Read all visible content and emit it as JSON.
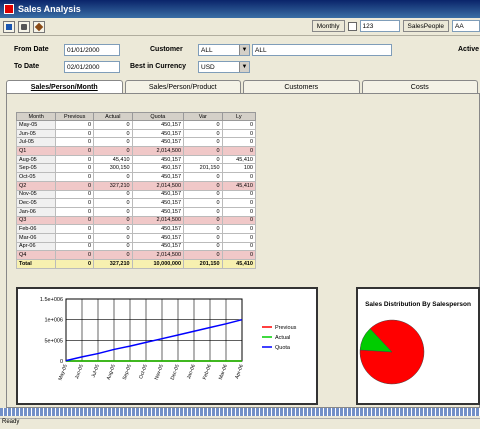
{
  "window": {
    "title": "Sales Analysis"
  },
  "toolbar": {
    "icons": [
      "new-icon",
      "print-icon",
      "tools-icon"
    ]
  },
  "top_right": {
    "monthly_label": "Monthly",
    "value_field": "123",
    "sales_people_label": "SalesPeople",
    "sales_people_value": "AA"
  },
  "filters": {
    "from_date_label": "From Date",
    "from_date_value": "01/01/2000",
    "to_date_label": "To Date",
    "to_date_value": "02/01/2000",
    "customer_label": "Customer",
    "customer_value": "ALL",
    "customer_desc": "ALL",
    "best_currency_label": "Best in Currency",
    "best_currency_value": "USD",
    "active_label": "Active"
  },
  "tabs": [
    {
      "label": "Sales/Person/Month"
    },
    {
      "label": "Sales/Person/Product"
    },
    {
      "label": "Customers"
    },
    {
      "label": "Costs"
    }
  ],
  "table": {
    "headers": [
      "Month",
      "Previous",
      "Actual",
      "Quota",
      "Var",
      "Ly"
    ],
    "rows": [
      {
        "month": "May-05",
        "previous": "0",
        "actual": "0",
        "quota": "450,157",
        "var": "0",
        "ly": "0",
        "quarter": false
      },
      {
        "month": "Jun-05",
        "previous": "0",
        "actual": "0",
        "quota": "450,157",
        "var": "0",
        "ly": "0",
        "quarter": false
      },
      {
        "month": "Jul-05",
        "previous": "0",
        "actual": "0",
        "quota": "450,157",
        "var": "0",
        "ly": "0",
        "quarter": false
      },
      {
        "month": "Q1",
        "previous": "0",
        "actual": "0",
        "quota": "2,014,500",
        "var": "0",
        "ly": "0",
        "quarter": true
      },
      {
        "month": "Aug-05",
        "previous": "0",
        "actual": "45,410",
        "quota": "450,157",
        "var": "0",
        "ly": "45,410",
        "quarter": false
      },
      {
        "month": "Sep-05",
        "previous": "0",
        "actual": "300,150",
        "quota": "450,157",
        "var": "201,150",
        "ly": "100",
        "quarter": false
      },
      {
        "month": "Oct-05",
        "previous": "0",
        "actual": "0",
        "quota": "450,157",
        "var": "0",
        "ly": "0",
        "quarter": false
      },
      {
        "month": "Q2",
        "previous": "0",
        "actual": "327,210",
        "quota": "2,014,500",
        "var": "0",
        "ly": "45,410",
        "quarter": true
      },
      {
        "month": "Nov-05",
        "previous": "0",
        "actual": "0",
        "quota": "450,157",
        "var": "0",
        "ly": "0",
        "quarter": false
      },
      {
        "month": "Dec-05",
        "previous": "0",
        "actual": "0",
        "quota": "450,157",
        "var": "0",
        "ly": "0",
        "quarter": false
      },
      {
        "month": "Jan-06",
        "previous": "0",
        "actual": "0",
        "quota": "450,157",
        "var": "0",
        "ly": "0",
        "quarter": false
      },
      {
        "month": "Q3",
        "previous": "0",
        "actual": "0",
        "quota": "2,014,500",
        "var": "0",
        "ly": "0",
        "quarter": true
      },
      {
        "month": "Feb-06",
        "previous": "0",
        "actual": "0",
        "quota": "450,157",
        "var": "0",
        "ly": "0",
        "quarter": false
      },
      {
        "month": "Mar-06",
        "previous": "0",
        "actual": "0",
        "quota": "450,157",
        "var": "0",
        "ly": "0",
        "quarter": false
      },
      {
        "month": "Apr-06",
        "previous": "0",
        "actual": "0",
        "quota": "450,157",
        "var": "0",
        "ly": "0",
        "quarter": false
      },
      {
        "month": "Q4",
        "previous": "0",
        "actual": "0",
        "quota": "2,014,500",
        "var": "0",
        "ly": "0",
        "quarter": true
      }
    ],
    "total": {
      "month": "Total",
      "previous": "0",
      "actual": "327,210",
      "quota": "10,000,000",
      "var": "201,150",
      "ly": "45,410"
    }
  },
  "chart_data": [
    {
      "type": "line",
      "categories": [
        "May-05",
        "Jun-05",
        "Jul-05",
        "Aug-05",
        "Sep-05",
        "Oct-05",
        "Nov-05",
        "Dec-05",
        "Jan-06",
        "Feb-06",
        "Mar-06",
        "Apr-06"
      ],
      "yticks": [
        "0",
        "5e+005",
        "1e+006",
        "1.5e+006"
      ],
      "ylim": [
        0,
        1500000
      ],
      "series": [
        {
          "name": "Previous",
          "color": "#ff0000",
          "values": [
            0,
            0,
            0,
            0,
            0,
            0,
            0,
            0,
            0,
            0,
            0,
            0
          ]
        },
        {
          "name": "Actual",
          "color": "#00cc00",
          "values": [
            0,
            0,
            0,
            0,
            0,
            0,
            0,
            0,
            0,
            0,
            0,
            0
          ]
        },
        {
          "name": "Quota",
          "color": "#0000ff",
          "values": [
            10000,
            100000,
            180000,
            280000,
            360000,
            450000,
            540000,
            630000,
            720000,
            810000,
            900000,
            1000000
          ]
        }
      ]
    },
    {
      "type": "pie",
      "title": "Sales Distribution By Salesperson",
      "slices": [
        {
          "value": 88,
          "color": "#ff0000"
        },
        {
          "value": 12,
          "color": "#00cc00"
        }
      ]
    }
  ],
  "statusbar": {
    "text": "Ready"
  }
}
